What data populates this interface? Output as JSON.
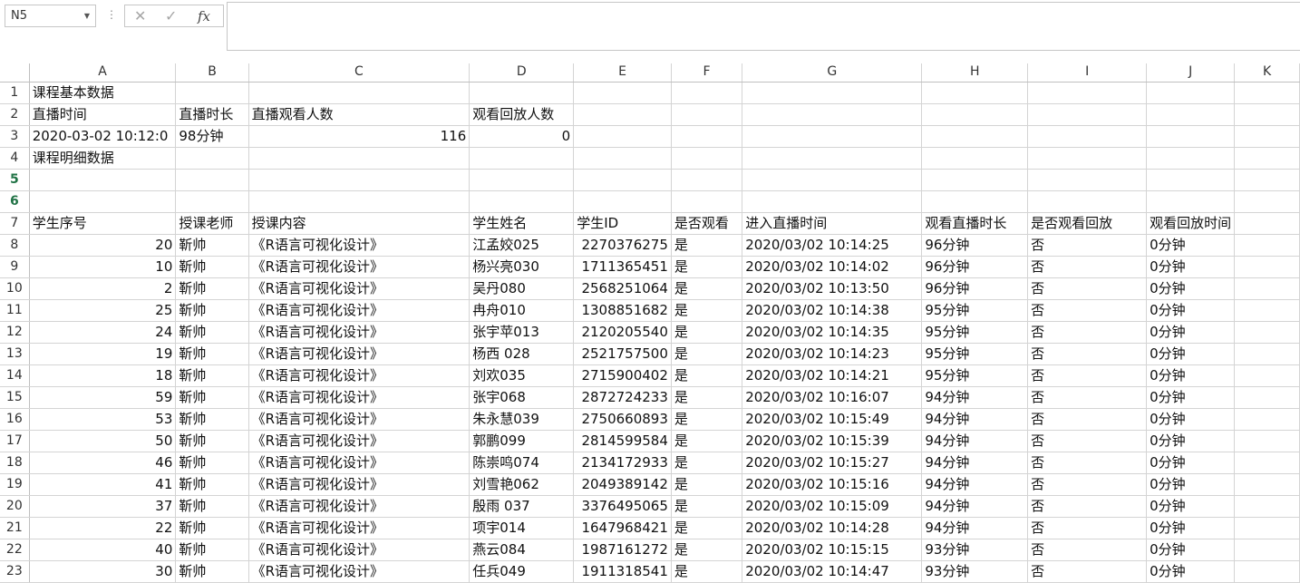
{
  "formula_bar": {
    "name_box": "N5",
    "formula_value": ""
  },
  "columns": [
    "A",
    "B",
    "C",
    "D",
    "E",
    "F",
    "G",
    "H",
    "I",
    "J",
    "K"
  ],
  "rows": [
    {
      "n": "1",
      "cells": [
        "课程基本数据",
        "",
        "",
        "",
        "",
        "",
        "",
        "",
        "",
        "",
        ""
      ]
    },
    {
      "n": "2",
      "cells": [
        "直播时间",
        "直播时长",
        "直播观看人数",
        "观看回放人数",
        "",
        "",
        "",
        "",
        "",
        "",
        ""
      ]
    },
    {
      "n": "3",
      "cells": [
        "2020-03-02 10:12:0",
        "98分钟",
        "116",
        "0",
        "",
        "",
        "",
        "",
        "",
        "",
        ""
      ]
    },
    {
      "n": "4",
      "cells": [
        "课程明细数据",
        "",
        "",
        "",
        "",
        "",
        "",
        "",
        "",
        "",
        ""
      ]
    },
    {
      "n": "5",
      "cells": [
        "",
        "",
        "",
        "",
        "",
        "",
        "",
        "",
        "",
        "",
        ""
      ]
    },
    {
      "n": "6",
      "cells": [
        "",
        "",
        "",
        "",
        "",
        "",
        "",
        "",
        "",
        "",
        ""
      ]
    },
    {
      "n": "7",
      "cells": [
        "学生序号",
        "授课老师",
        "授课内容",
        "学生姓名",
        "学生ID",
        "是否观看",
        "进入直播时间",
        "观看直播时长",
        "是否观看回放",
        "观看回放时间",
        ""
      ]
    },
    {
      "n": "8",
      "cells": [
        "20",
        "靳帅",
        "《R语言可视化设计》",
        "江孟姣025",
        "2270376275",
        "是",
        "2020/03/02  10:14:25",
        "96分钟",
        "否",
        "0分钟",
        ""
      ]
    },
    {
      "n": "9",
      "cells": [
        "10",
        "靳帅",
        "《R语言可视化设计》",
        "杨兴亮030",
        "1711365451",
        "是",
        "2020/03/02  10:14:02",
        "96分钟",
        "否",
        "0分钟",
        ""
      ]
    },
    {
      "n": "10",
      "cells": [
        "2",
        "靳帅",
        "《R语言可视化设计》",
        "吴丹080",
        "2568251064",
        "是",
        "2020/03/02  10:13:50",
        "96分钟",
        "否",
        "0分钟",
        ""
      ]
    },
    {
      "n": "11",
      "cells": [
        "25",
        "靳帅",
        "《R语言可视化设计》",
        "冉舟010",
        "1308851682",
        "是",
        "2020/03/02  10:14:38",
        "95分钟",
        "否",
        "0分钟",
        ""
      ]
    },
    {
      "n": "12",
      "cells": [
        "24",
        "靳帅",
        "《R语言可视化设计》",
        "张宇苹013",
        "2120205540",
        "是",
        "2020/03/02  10:14:35",
        "95分钟",
        "否",
        "0分钟",
        ""
      ]
    },
    {
      "n": "13",
      "cells": [
        "19",
        "靳帅",
        "《R语言可视化设计》",
        "杨西  028",
        "2521757500",
        "是",
        "2020/03/02  10:14:23",
        "95分钟",
        "否",
        "0分钟",
        ""
      ]
    },
    {
      "n": "14",
      "cells": [
        "18",
        "靳帅",
        "《R语言可视化设计》",
        "刘欢035",
        "2715900402",
        "是",
        "2020/03/02  10:14:21",
        "95分钟",
        "否",
        "0分钟",
        ""
      ]
    },
    {
      "n": "15",
      "cells": [
        "59",
        "靳帅",
        "《R语言可视化设计》",
        "张宇068",
        "2872724233",
        "是",
        "2020/03/02  10:16:07",
        "94分钟",
        "否",
        "0分钟",
        ""
      ]
    },
    {
      "n": "16",
      "cells": [
        "53",
        "靳帅",
        "《R语言可视化设计》",
        "朱永慧039",
        "2750660893",
        "是",
        "2020/03/02  10:15:49",
        "94分钟",
        "否",
        "0分钟",
        ""
      ]
    },
    {
      "n": "17",
      "cells": [
        "50",
        "靳帅",
        "《R语言可视化设计》",
        "郭鹏099",
        "2814599584",
        "是",
        "2020/03/02  10:15:39",
        "94分钟",
        "否",
        "0分钟",
        ""
      ]
    },
    {
      "n": "18",
      "cells": [
        "46",
        "靳帅",
        "《R语言可视化设计》",
        "陈崇鸣074",
        "2134172933",
        "是",
        "2020/03/02  10:15:27",
        "94分钟",
        "否",
        "0分钟",
        ""
      ]
    },
    {
      "n": "19",
      "cells": [
        "41",
        "靳帅",
        "《R语言可视化设计》",
        "刘雪艳062",
        "2049389142",
        "是",
        "2020/03/02  10:15:16",
        "94分钟",
        "否",
        "0分钟",
        ""
      ]
    },
    {
      "n": "20",
      "cells": [
        "37",
        "靳帅",
        "《R语言可视化设计》",
        "殷雨  037",
        "3376495065",
        "是",
        "2020/03/02  10:15:09",
        "94分钟",
        "否",
        "0分钟",
        ""
      ]
    },
    {
      "n": "21",
      "cells": [
        "22",
        "靳帅",
        "《R语言可视化设计》",
        "项宇014",
        "1647968421",
        "是",
        "2020/03/02  10:14:28",
        "94分钟",
        "否",
        "0分钟",
        ""
      ]
    },
    {
      "n": "22",
      "cells": [
        "40",
        "靳帅",
        "《R语言可视化设计》",
        "燕云084",
        "1987161272",
        "是",
        "2020/03/02  10:15:15",
        "93分钟",
        "否",
        "0分钟",
        ""
      ]
    },
    {
      "n": "23",
      "cells": [
        "30",
        "靳帅",
        "《R语言可视化设计》",
        "任兵049",
        "1911318541",
        "是",
        "2020/03/02  10:14:47",
        "93分钟",
        "否",
        "0分钟",
        ""
      ]
    }
  ]
}
